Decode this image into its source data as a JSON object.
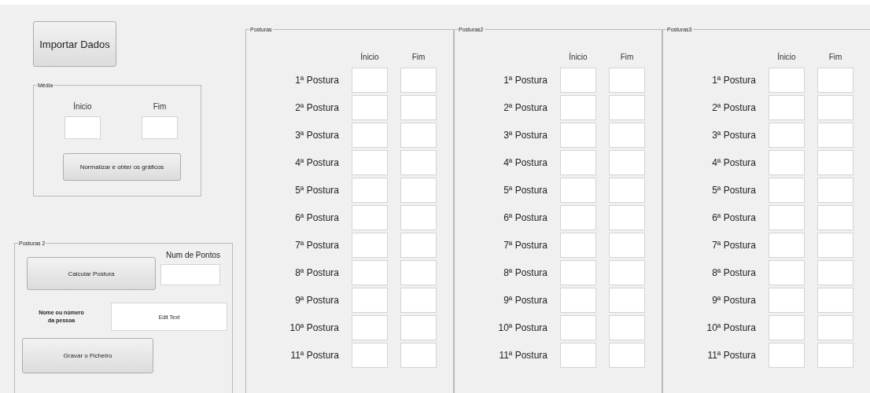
{
  "import_button": "Importar Dados",
  "media": {
    "title": "Média",
    "start_label": "Ínicio",
    "end_label": "Fim",
    "button": "Normalizar e obter os gráficos"
  },
  "posturas2": {
    "title": "Posturas 2",
    "calc_button": "Calcular Postura",
    "points_label": "Num de Pontos",
    "name_label": "Nome ou número da pessoa",
    "name_field_value": "Edit Text",
    "save_button": "Gravar o Ficheiro"
  },
  "panels": [
    {
      "title": "Posturas",
      "start_header": "Ínicio",
      "end_header": "Fim",
      "rows": [
        "1ª Postura",
        "2ª Postura",
        "3ª Postura",
        "4ª Postura",
        "5ª Postura",
        "6ª Postura",
        "7ª Postura",
        "8ª Postura",
        "9ª Postura",
        "10ª Postura",
        "11ª Postura"
      ]
    },
    {
      "title": "Posturas2",
      "start_header": "Ínicio",
      "end_header": "Fim",
      "rows": [
        "1ª Postura",
        "2ª Postura",
        "3ª Postura",
        "4ª Postura",
        "5ª Postura",
        "6ª Postura",
        "7ª Postura",
        "8ª Postura",
        "9ª Postura",
        "10ª Postura",
        "11ª Postura"
      ]
    },
    {
      "title": "Posturas3",
      "start_header": "Ínicio",
      "end_header": "Fim",
      "rows": [
        "1ª Postura",
        "2ª Postura",
        "3ª Postura",
        "4ª Postura",
        "5ª Postura",
        "6ª Postura",
        "7ª Postura",
        "8ª Postura",
        "9ª Postura",
        "10ª Postura",
        "11ª Postura"
      ]
    }
  ]
}
